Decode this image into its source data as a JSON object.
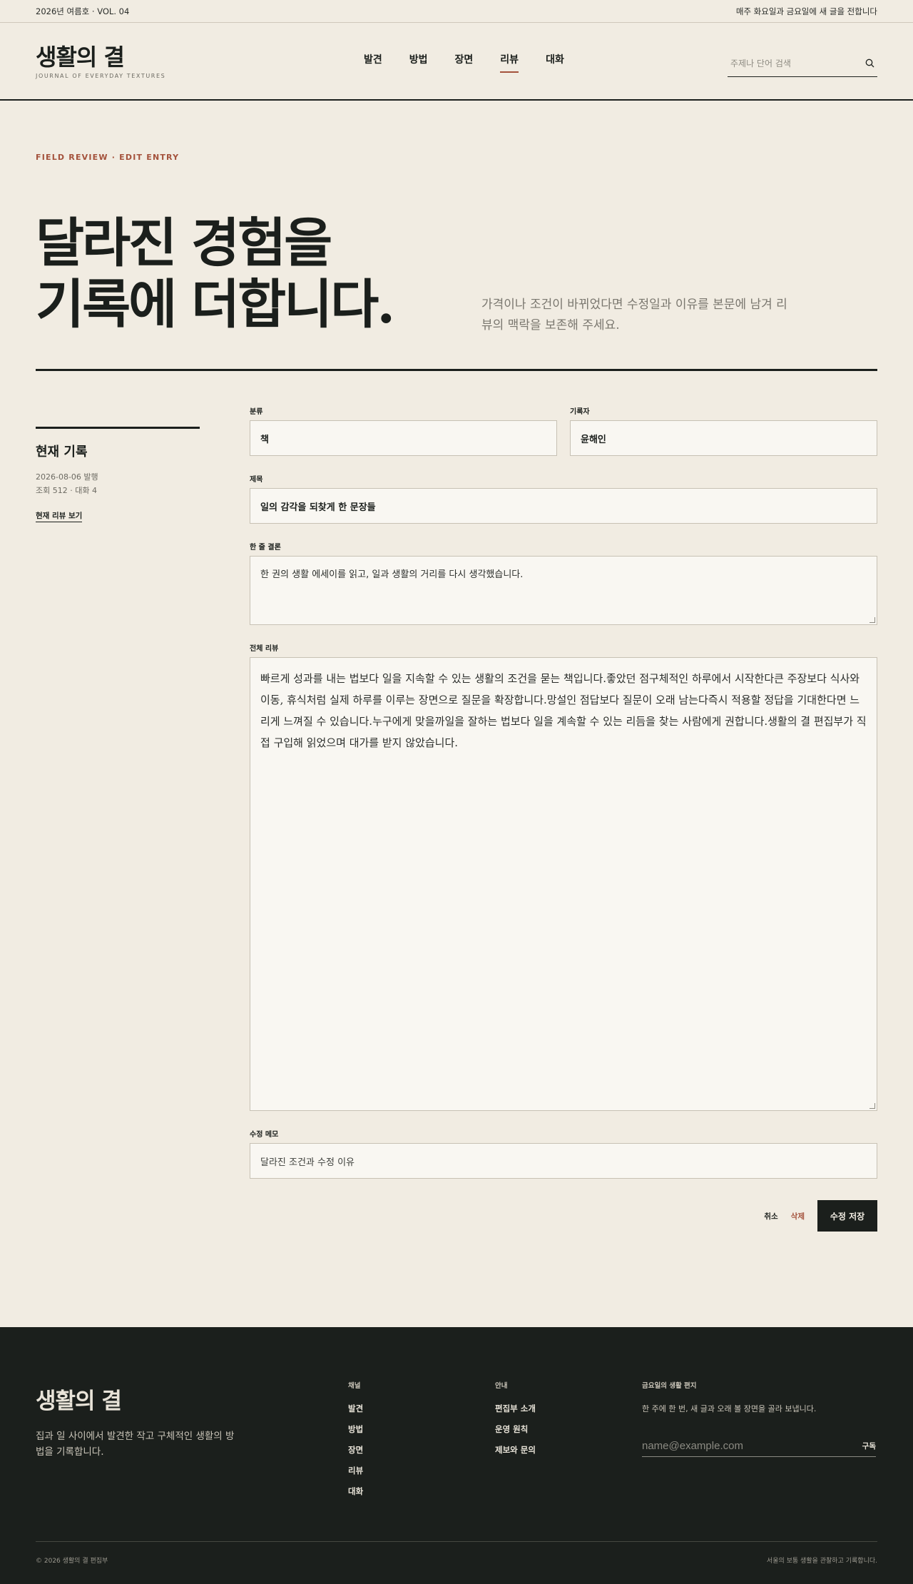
{
  "topbar": {
    "issue": "2026년 여름호 · VOL. 04",
    "schedule": "매주 화요일과 금요일에 새 글을 전합니다"
  },
  "header": {
    "brand_title": "생활의 결",
    "brand_subtitle": "JOURNAL OF EVERYDAY TEXTURES",
    "nav": [
      "발견",
      "방법",
      "장면",
      "리뷰",
      "대화"
    ],
    "active_nav": "리뷰",
    "search_placeholder": "주제나 단어 검색"
  },
  "hero": {
    "eyebrow": "FIELD REVIEW · EDIT ENTRY",
    "title_line1": "달라진 경험을",
    "title_line2": "기록에 더합니다.",
    "description": "가격이나 조건이 바뀌었다면 수정일과 이유를 본문에 남겨 리뷰의 맥락을 보존해 주세요."
  },
  "sidebar": {
    "title": "현재 기록",
    "published": "2026-08-06 발행",
    "stats": "조회 512 · 대화 4",
    "view_link": "현재 리뷰 보기"
  },
  "form": {
    "category_label": "분류",
    "category_value": "책",
    "author_label": "기록자",
    "author_value": "윤해인",
    "title_label": "제목",
    "title_value": "일의 감각을 되찾게 한 문장들",
    "summary_label": "한 줄 결론",
    "summary_value": "한 권의 생활 에세이를 읽고, 일과 생활의 거리를 다시 생각했습니다.",
    "body_label": "전체 리뷰",
    "body_value": "빠르게 성과를 내는 법보다 일을 지속할 수 있는 생활의 조건을 묻는 책입니다.좋았던 점구체적인 하루에서 시작한다큰 주장보다 식사와 이동, 휴식처럼 실제 하루를 이루는 장면으로 질문을 확장합니다.망설인 점답보다 질문이 오래 남는다즉시 적용할 정답을 기대한다면 느리게 느껴질 수 있습니다.누구에게 맞을까일을 잘하는 법보다 일을 계속할 수 있는 리듬을 찾는 사람에게 권합니다.생활의 결 편집부가 직접 구입해 읽었으며 대가를 받지 않았습니다.",
    "memo_label": "수정 메모",
    "memo_placeholder": "달라진 조건과 수정 이유",
    "cancel": "취소",
    "delete": "삭제",
    "save": "수정 저장"
  },
  "footer": {
    "brand": "생활의 결",
    "description": "집과 일 사이에서 발견한 작고 구체적인 생활의 방법을 기록합니다.",
    "channel_title": "채널",
    "channels": [
      "발견",
      "방법",
      "장면",
      "리뷰",
      "대화"
    ],
    "info_title": "안내",
    "info_links": [
      "편집부 소개",
      "운영 원칙",
      "제보와 문의"
    ],
    "newsletter_title": "금요일의 생활 편지",
    "newsletter_desc": "한 주에 한 번, 새 글과 오래 볼 장면을 골라 보냅니다.",
    "email_placeholder": "name@example.com",
    "subscribe": "구독",
    "copyright": "© 2026 생활의 결 편집부",
    "tagline": "서울의 보통 생활을 관찰하고 기록합니다."
  },
  "colors": {
    "background": "#f1ece2",
    "ink": "#1b1f1c",
    "accent": "#a4523c",
    "field": "#f9f7f2"
  }
}
